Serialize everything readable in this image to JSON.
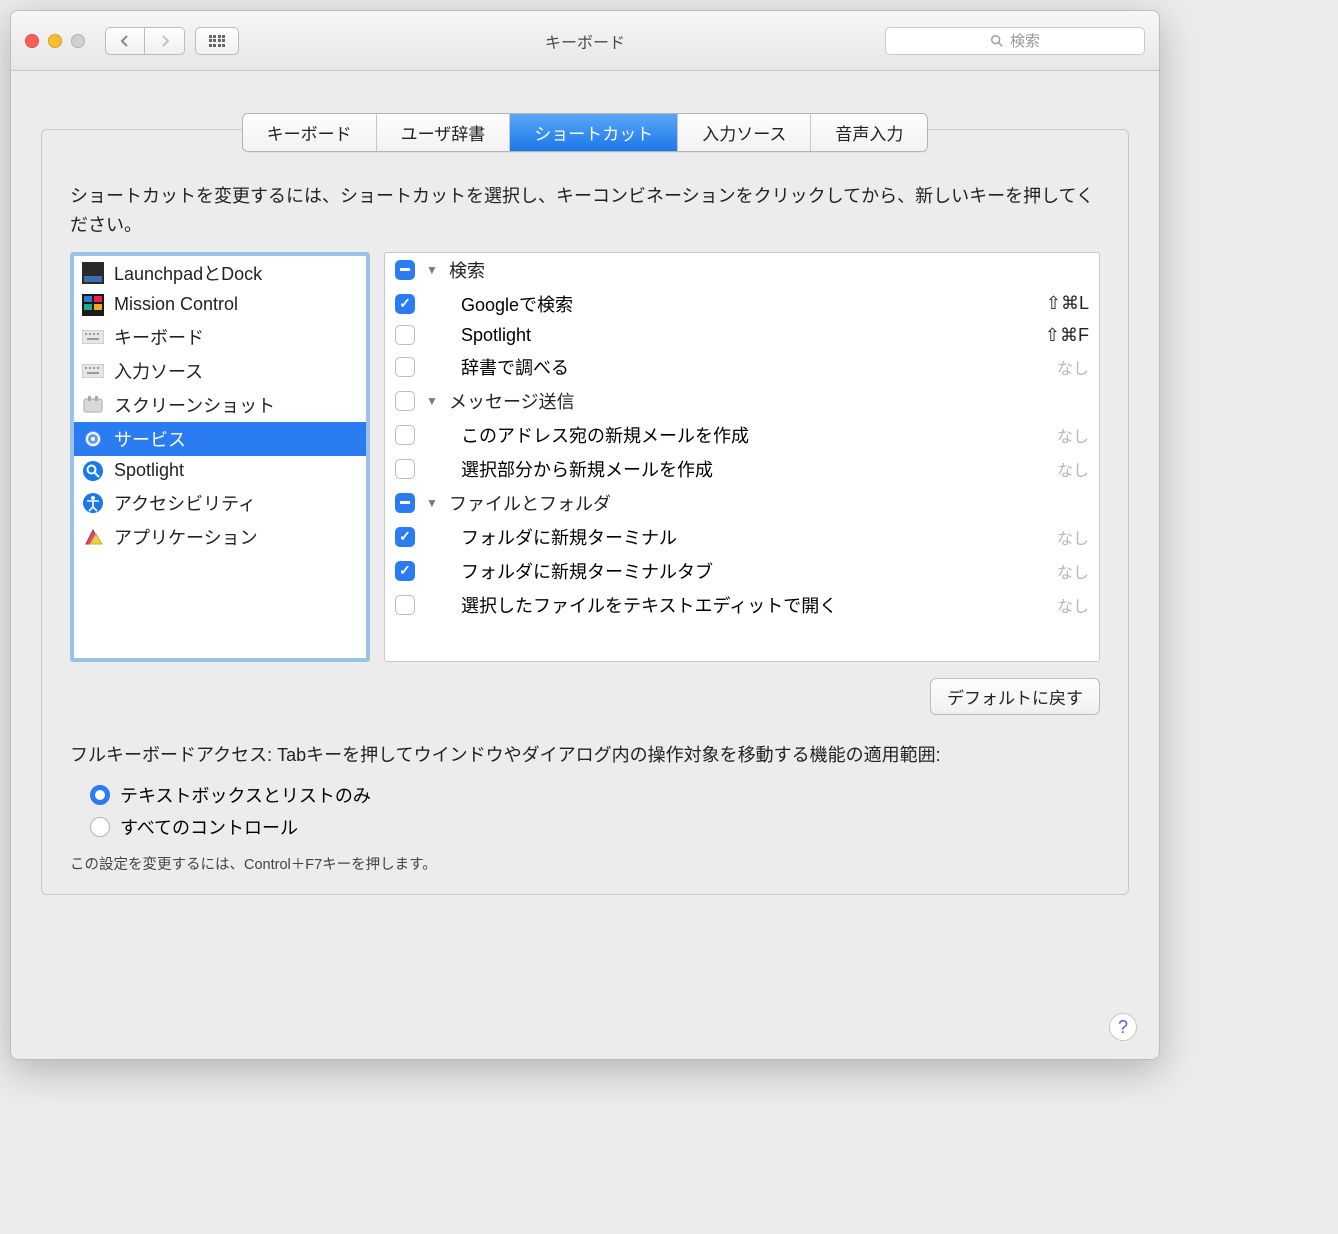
{
  "window": {
    "title": "キーボード",
    "search_placeholder": "検索"
  },
  "tabs": {
    "items": [
      "キーボード",
      "ユーザ辞書",
      "ショートカット",
      "入力ソース",
      "音声入力"
    ],
    "selected_index": 2
  },
  "instruction": "ショートカットを変更するには、ショートカットを選択し、キーコンビネーションをクリックしてから、新しいキーを押してください。",
  "categories": {
    "items": [
      {
        "label": "LaunchpadとDock",
        "icon": "launchpad"
      },
      {
        "label": "Mission Control",
        "icon": "mission"
      },
      {
        "label": "キーボード",
        "icon": "keyboard"
      },
      {
        "label": "入力ソース",
        "icon": "keyboard"
      },
      {
        "label": "スクリーンショット",
        "icon": "screenshot"
      },
      {
        "label": "サービス",
        "icon": "gear"
      },
      {
        "label": "Spotlight",
        "icon": "spotlight"
      },
      {
        "label": "アクセシビリティ",
        "icon": "accessibility"
      },
      {
        "label": "アプリケーション",
        "icon": "apps"
      }
    ],
    "selected_index": 5
  },
  "shortcuts": {
    "groups": [
      {
        "label": "検索",
        "state": "mixed",
        "items": [
          {
            "label": "Googleで検索",
            "checked": true,
            "shortcut": "⇧⌘L"
          },
          {
            "label": "Spotlight",
            "checked": false,
            "shortcut": "⇧⌘F"
          },
          {
            "label": "辞書で調べる",
            "checked": false,
            "shortcut": "なし",
            "dim": true
          }
        ]
      },
      {
        "label": "メッセージ送信",
        "state": "unchecked",
        "items": [
          {
            "label": "このアドレス宛の新規メールを作成",
            "checked": false,
            "shortcut": "なし",
            "dim": true
          },
          {
            "label": "選択部分から新規メールを作成",
            "checked": false,
            "shortcut": "なし",
            "dim": true
          }
        ]
      },
      {
        "label": "ファイルとフォルダ",
        "state": "mixed",
        "items": [
          {
            "label": "フォルダに新規ターミナル",
            "checked": true,
            "shortcut": "なし",
            "dim": true
          },
          {
            "label": "フォルダに新規ターミナルタブ",
            "checked": true,
            "shortcut": "なし",
            "dim": true
          },
          {
            "label": "選択したファイルをテキストエディットで開く",
            "checked": false,
            "shortcut": "なし",
            "dim": true
          }
        ]
      }
    ]
  },
  "defaults_button": "デフォルトに戻す",
  "fka": {
    "text": "フルキーボードアクセス: Tabキーを押してウインドウやダイアログ内の操作対象を移動する機能の適用範囲:",
    "radios": [
      {
        "label": "テキストボックスとリストのみ",
        "checked": true
      },
      {
        "label": "すべてのコントロール",
        "checked": false
      }
    ],
    "hint": "この設定を変更するには、Control＋F7キーを押します。"
  }
}
